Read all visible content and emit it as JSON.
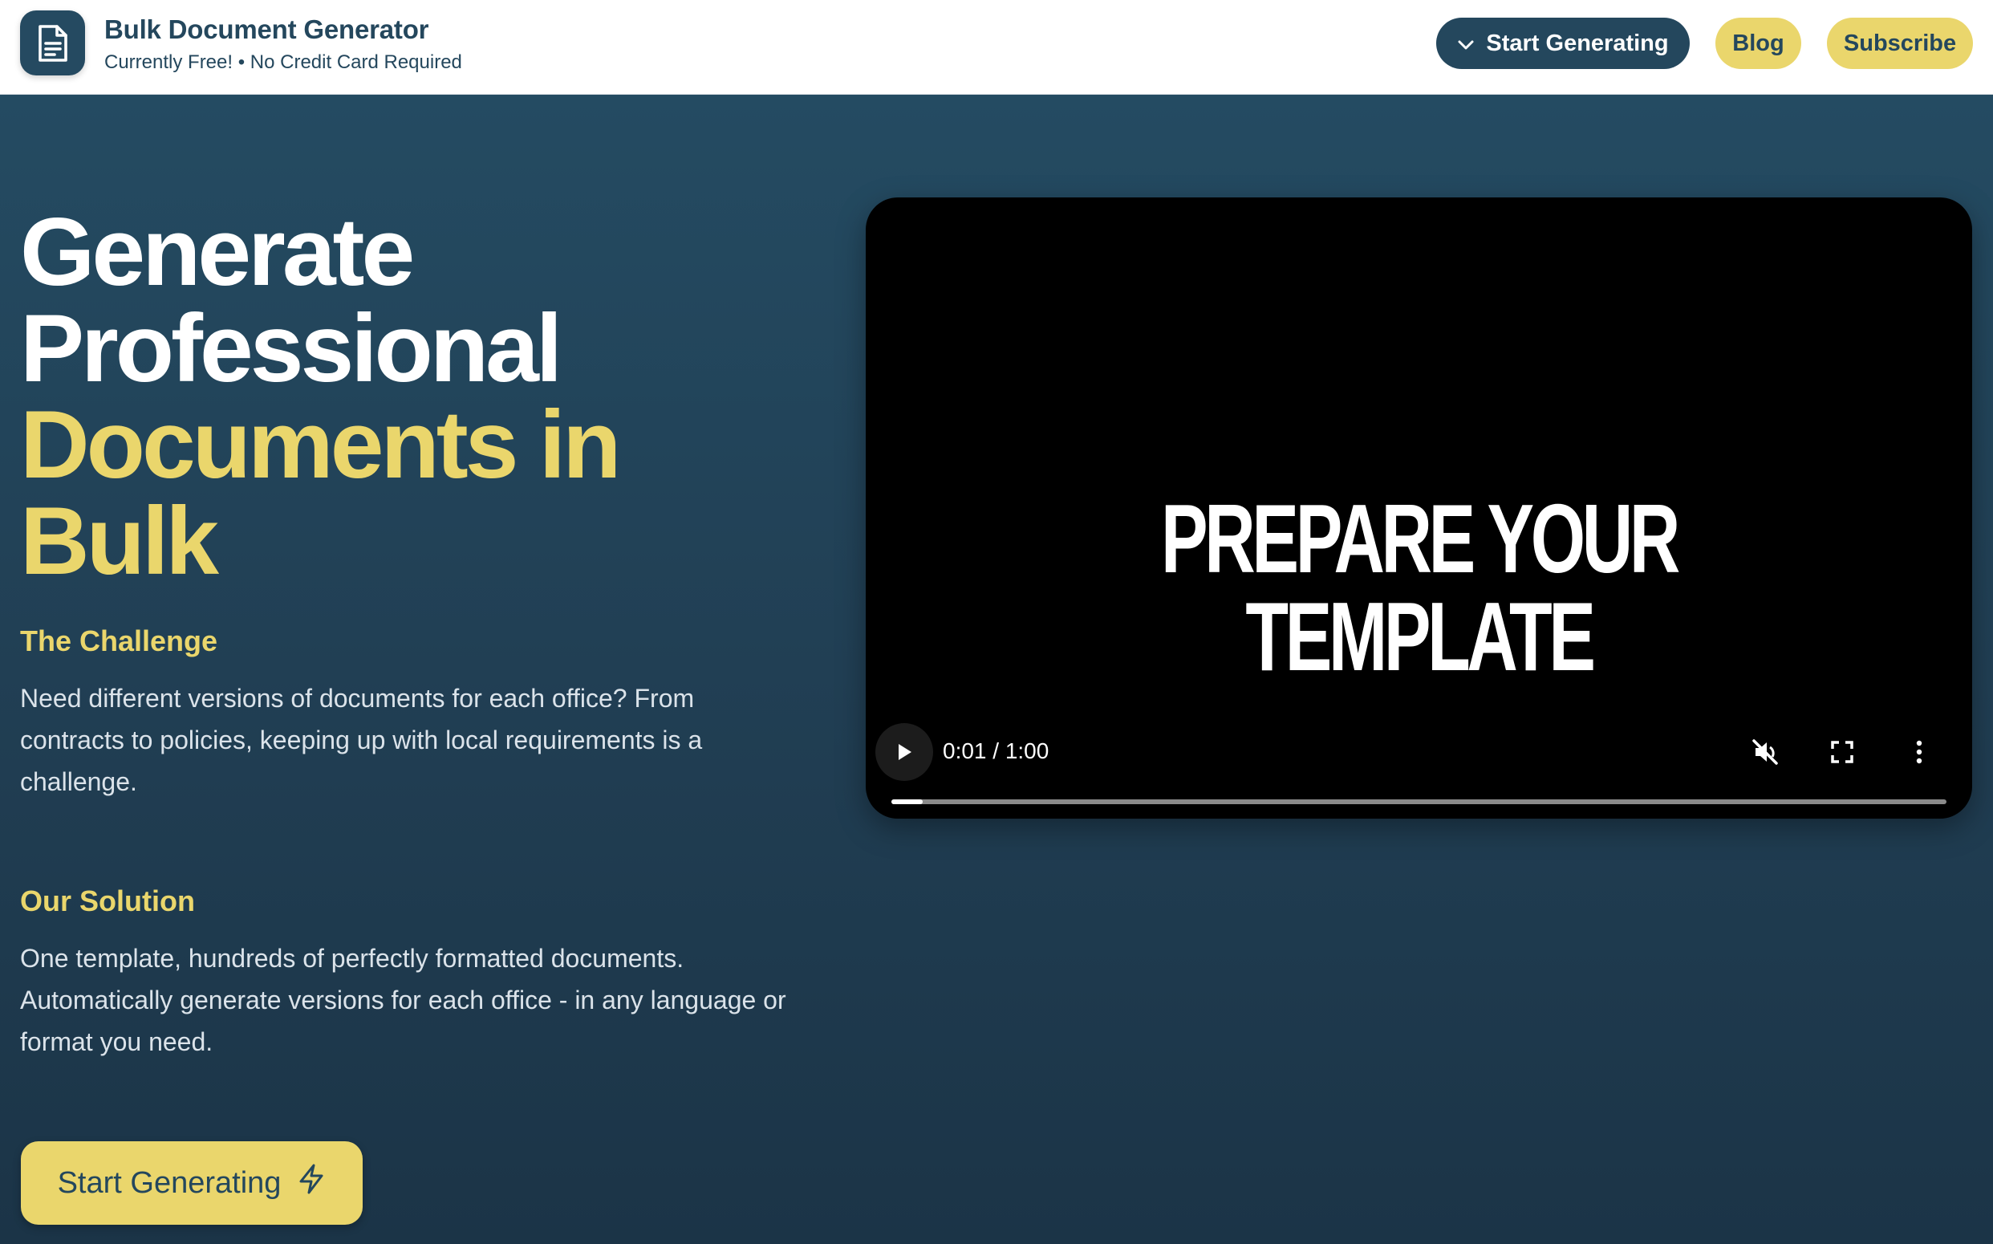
{
  "header": {
    "brand_title": "Bulk Document Generator",
    "brand_subtitle": "Currently Free! • No Credit Card Required",
    "logo_icon": "document-icon",
    "nav": {
      "start_label": "Start Generating",
      "start_icon": "chevron-down-icon",
      "blog_label": "Blog",
      "subscribe_label": "Subscribe"
    }
  },
  "hero": {
    "title_lines": [
      "Generate",
      "Professional",
      "Documents in",
      "Bulk"
    ],
    "challenge": {
      "heading": "The Challenge",
      "body": "Need different versions of documents for each office? From contracts to policies, keeping up with local requirements is a challenge."
    },
    "solution": {
      "heading": "Our Solution",
      "body": "One template, hundreds of perfectly formatted documents. Automatically generate versions for each office - in any language or format you need."
    },
    "cta": {
      "label": "Start Generating",
      "icon": "lightning-icon"
    }
  },
  "video": {
    "caption": "PREPARE YOUR TEMPLATE",
    "time": "0:01 / 1:00",
    "progress": 0.03,
    "muted": true,
    "controls": [
      "play-icon",
      "muted-speaker-icon",
      "fullscreen-icon",
      "more-vertical-icon"
    ]
  },
  "colors": {
    "primary": "#24475d",
    "accent": "#ead66c",
    "hero_bg": "#213f54",
    "video_bg": "#000000"
  }
}
